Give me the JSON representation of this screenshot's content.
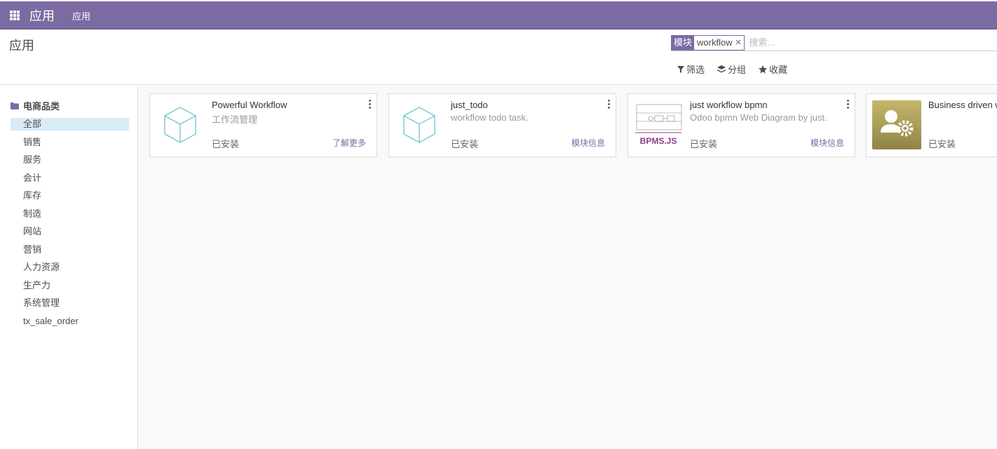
{
  "navbar": {
    "brand": "应用",
    "menu": "应用"
  },
  "control_panel": {
    "breadcrumb": "应用",
    "search": {
      "facet_label": "模块",
      "facet_value": "workflow",
      "placeholder": "搜索..."
    },
    "filters": {
      "filter_label": "筛选",
      "group_label": "分组",
      "favorites_label": "收藏"
    }
  },
  "sidebar": {
    "header": "电商品类",
    "items": [
      "全部",
      "销售",
      "服务",
      "会计",
      "库存",
      "制造",
      "网站",
      "营销",
      "人力资源",
      "生产力",
      "系统管理",
      "tx_sale_order"
    ]
  },
  "cards": [
    {
      "title": "Powerful Workflow",
      "summary": "工作流管理",
      "status": "已安装",
      "link": "了解更多",
      "icon": "cube-icon"
    },
    {
      "title": "just_todo",
      "summary": "workflow todo task.",
      "status": "已安装",
      "link": "模块信息",
      "icon": "cube-icon"
    },
    {
      "title": "just workflow bpmn",
      "summary": "Odoo bpmn Web Diagram by just.",
      "status": "已安装",
      "link": "模块信息",
      "icon": "bpmn-diagram-icon",
      "icon_text": "BPMS.JS"
    },
    {
      "title": "Business driven w",
      "summary": "",
      "status": "已安装",
      "link": "",
      "icon": "user-gear-icon"
    }
  ],
  "colors": {
    "primary": "#7c6aa3",
    "active_bg": "#d9ebf7",
    "cube": "#5bc0c6"
  }
}
